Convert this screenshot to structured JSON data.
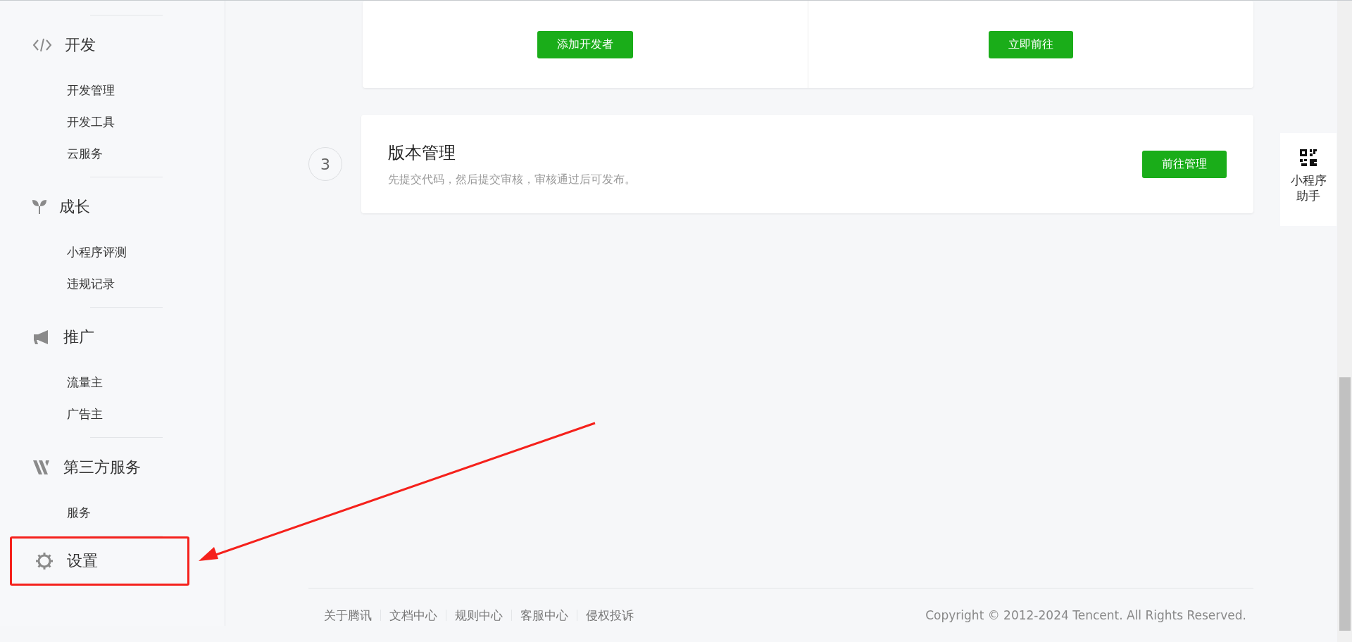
{
  "sidebar": {
    "sections": [
      {
        "kind": "code",
        "label": "开发",
        "items": [
          "开发管理",
          "开发工具",
          "云服务"
        ],
        "highlighted": false
      },
      {
        "kind": "sprout",
        "label": "成长",
        "items": [
          "小程序评测",
          "违规记录"
        ],
        "highlighted": false
      },
      {
        "kind": "megaphone",
        "label": "推广",
        "items": [
          "流量主",
          "广告主"
        ],
        "highlighted": false
      },
      {
        "kind": "third",
        "label": "第三方服务",
        "items": [
          "服务"
        ],
        "highlighted": false
      },
      {
        "kind": "gear",
        "label": "设置",
        "highlighted": true
      }
    ]
  },
  "top_card": {
    "buttons": [
      "添加开发者",
      "立即前往"
    ]
  },
  "steps": [
    {
      "number": "3",
      "title": "版本管理",
      "description": "先提交代码，然后提交审核，审核通过后可发布。",
      "button": "前往管理"
    }
  ],
  "helper": {
    "label": "小程序助手"
  },
  "footer": {
    "links": [
      "关于腾讯",
      "文档中心",
      "规则中心",
      "客服中心",
      "侵权投诉"
    ],
    "copyright": "Copyright © 2012-2024 Tencent. All Rights Reserved."
  },
  "annotation": {
    "arrow": true
  }
}
